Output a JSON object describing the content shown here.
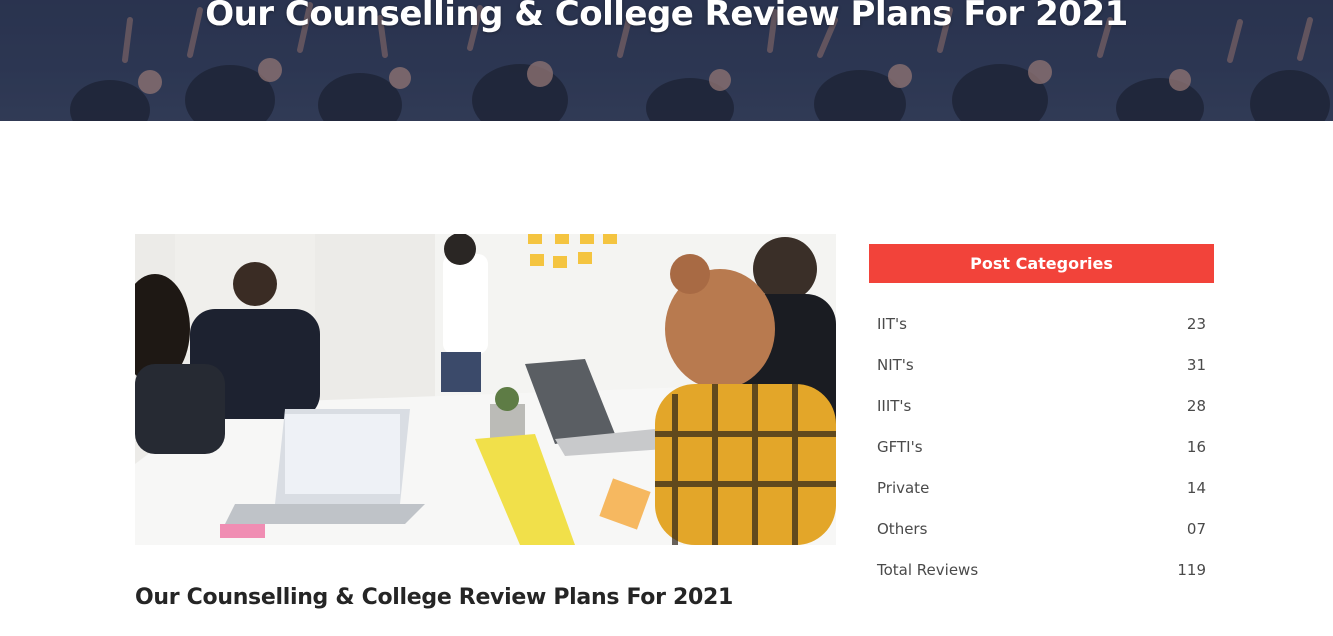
{
  "hero": {
    "title": "Our Counselling & College Review Plans For 2021"
  },
  "post": {
    "image_alt": "Students collaborating at a table with laptops and sticky notes",
    "title": "Our Counselling & College Review Plans For 2021"
  },
  "sidebar": {
    "header": "Post Categories",
    "accent_color": "#f2433a",
    "categories": [
      {
        "label": "IIT's",
        "count": "23"
      },
      {
        "label": "NIT's",
        "count": "31"
      },
      {
        "label": "IIIT's",
        "count": "28"
      },
      {
        "label": "GFTI's",
        "count": "16"
      },
      {
        "label": "Private",
        "count": "14"
      },
      {
        "label": "Others",
        "count": "07"
      },
      {
        "label": "Total Reviews",
        "count": "119"
      }
    ]
  }
}
